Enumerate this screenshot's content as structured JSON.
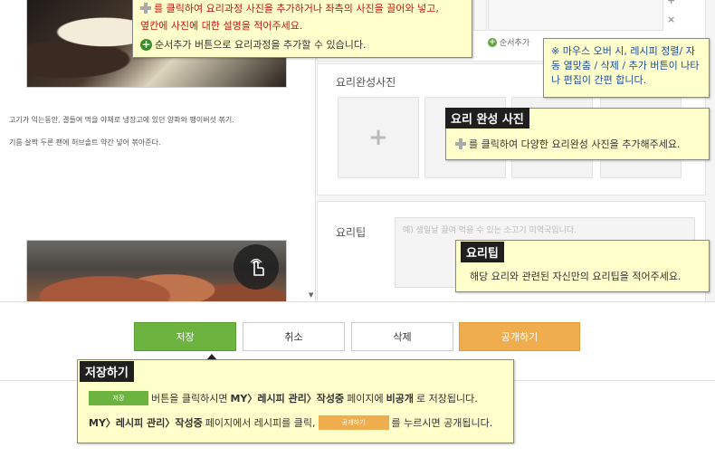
{
  "preview": {
    "caption_1": "고기가 익는동안, 결들여 먹을 야채로 냉장고에 있던 양파와 팽이버섯 볶기.",
    "caption_2": "기름 살짝 두른 팬에 허브솔트 약간 넣어 볶아준다."
  },
  "steps": {
    "add_label": "순서추가"
  },
  "complete": {
    "label": "요리완성사진"
  },
  "tip": {
    "label": "요리팁",
    "placeholder": "예) 생일날 끓여 먹을 수 있는 소고기 미역국입니다."
  },
  "buttons": {
    "save": "저장",
    "cancel": "취소",
    "delete": "삭제",
    "publish": "공개하기"
  },
  "tooltips": {
    "step": {
      "line1": "를 클릭하여 요리과정 사진을 추가하거나 좌측의 사진을 끌어와 넣고,",
      "line2": "옆칸에 사진에 대한 설명을 적어주세요.",
      "line3": "순서추가 버튼으로 요리과정을 추가할 수 있습니다."
    },
    "hover": {
      "text": "※ 마우스 오버 시, 레시피 정렬/ 자동 열맞춤 / 삭제 / 추가 버튼이 나타나 편집이 간편 합니다."
    },
    "complete": {
      "title": "요리 완성 사진",
      "text": "를 클릭하여 다양한 요리완성 사진을 추가해주세요."
    },
    "recipe_tip": {
      "title": "요리팁",
      "text": "해당 요리와 관련된 자신만의 요리팁을 적어주세요."
    },
    "save": {
      "title": "저장하기",
      "mini_save": "저장",
      "line1_a": "버튼을 클릭하시면",
      "line1_b": "MY〉레시피 관리〉작성중",
      "line1_c": "페이지에",
      "line1_d": "비공개",
      "line1_e": "로 저장됩니다.",
      "line2_a": "MY〉레시피 관리〉작성중",
      "line2_b": "페이지에서 레시피를 클릭,",
      "mini_publish": "공개하기",
      "line2_c": "를 누르시면 공개됩니다."
    }
  },
  "colors": {
    "save_green": "#6db33f",
    "publish_orange": "#f0ad4e",
    "tooltip_bg": "#ffffcc"
  }
}
